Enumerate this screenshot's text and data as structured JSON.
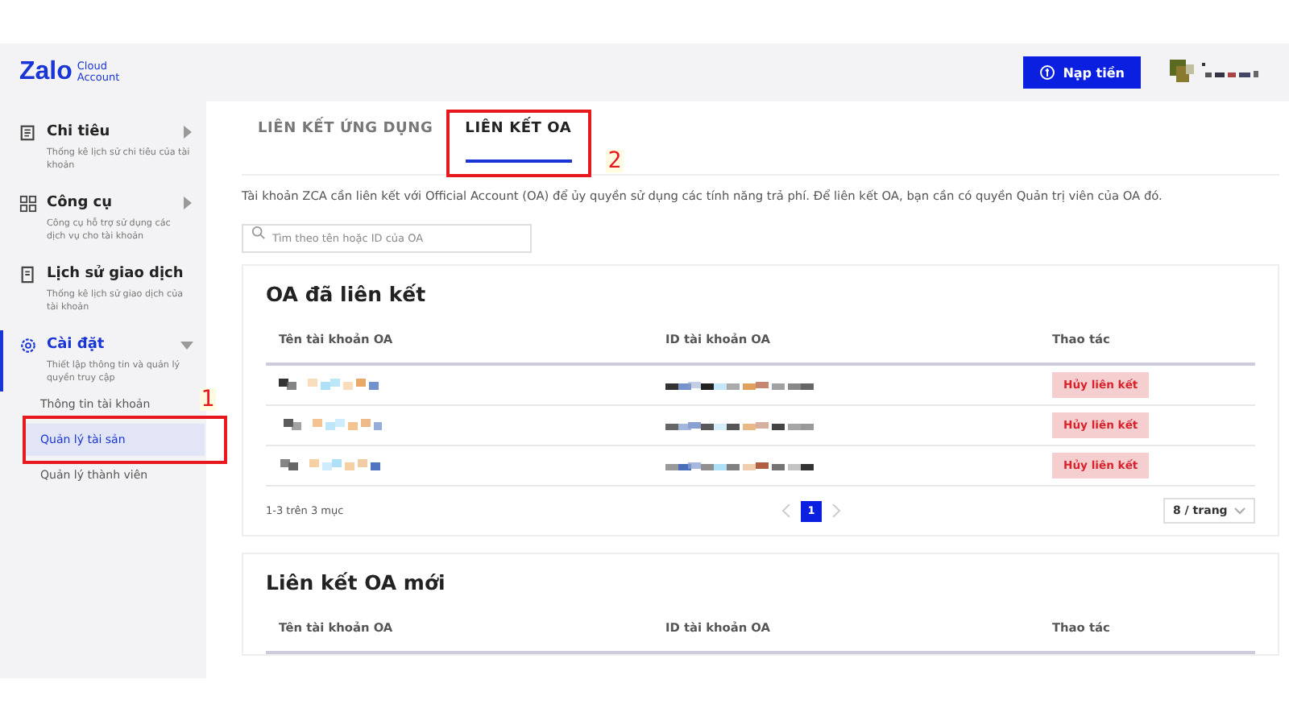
{
  "logo": {
    "brand": "Zalo",
    "sub_line1": "Cloud",
    "sub_line2": "Account"
  },
  "header": {
    "topup_button": "Nạp tiền"
  },
  "sidebar": {
    "items": [
      {
        "kind": "chart",
        "title": "Chi tiêu",
        "desc": "Thống kê lịch sử chi tiêu của tài khoản",
        "selected": false,
        "expanded": false
      },
      {
        "kind": "tools",
        "title": "Công cụ",
        "desc": "Công cụ hỗ trợ sử dụng các dịch vụ cho tài khoản",
        "selected": false,
        "expanded": false
      },
      {
        "kind": "history",
        "title": "Lịch sử giao dịch",
        "desc": "Thống kê lịch sử giao dịch của tài khoản",
        "selected": false
      },
      {
        "kind": "settings",
        "title": "Cài đặt",
        "desc": "Thiết lập thông tin và quản lý quyền truy cập",
        "selected": true,
        "expanded": true,
        "children": [
          {
            "label": "Thông tin tài khoản",
            "selected": false
          },
          {
            "label": "Quản lý tài sản",
            "selected": true
          },
          {
            "label": "Quản lý thành viên",
            "selected": false
          }
        ]
      }
    ]
  },
  "tabs": [
    {
      "label": "LIÊN KẾT ỨNG DỤNG",
      "selected": false
    },
    {
      "label": "LIÊN KẾT OA",
      "selected": true
    }
  ],
  "description": "Tài khoản ZCA cần liên kết với Official Account (OA) để ủy quyền sử dụng các tính năng trả phí. Để liên kết OA, bạn cần có quyền Quản trị viên của OA đó.",
  "search": {
    "placeholder": "Tìm theo tên hoặc ID của OA"
  },
  "linked_card": {
    "title": "OA đã liên kết",
    "columns": [
      "Tên tài khoản OA",
      "ID tài khoản OA",
      "Thao tác"
    ],
    "rows": [
      {
        "action": "Hủy liên kết"
      },
      {
        "action": "Hủy liên kết"
      },
      {
        "action": "Hủy liên kết"
      }
    ],
    "summary": "1-3 trên 3 mục",
    "pages": [
      {
        "label": "1",
        "selected": true
      }
    ],
    "page_size": "8 / trang"
  },
  "new_card": {
    "title": "Liên kết OA mới",
    "columns": [
      "Tên tài khoản OA",
      "ID tài khoản OA",
      "Thao tác"
    ]
  },
  "annotations": [
    {
      "number": "2"
    },
    {
      "number": "1"
    }
  ]
}
